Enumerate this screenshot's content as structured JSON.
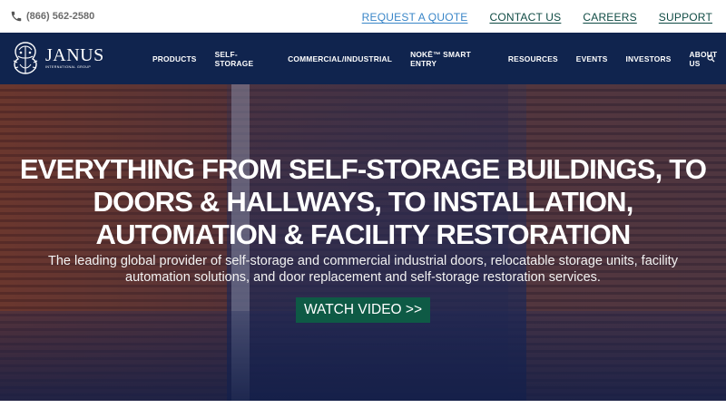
{
  "topbar": {
    "phone_icon": "phone-icon",
    "phone": "(866) 562-2580",
    "links": [
      "REQUEST A QUOTE",
      "CONTACT US",
      "CAREERS",
      "SUPPORT"
    ]
  },
  "navbar": {
    "logo": {
      "word": "JANUS",
      "sub": "INTERNATIONAL GROUP"
    },
    "items": [
      "PRODUCTS",
      "SELF-STORAGE",
      "COMMERCIAL/INDUSTRIAL",
      "NOKĒ™ SMART ENTRY",
      "RESOURCES",
      "EVENTS",
      "INVESTORS",
      "ABOUT US"
    ],
    "search_icon": "search-icon"
  },
  "hero": {
    "headline": "EVERYTHING FROM SELF-STORAGE BUILDINGS, TO DOORS & HALLWAYS, TO INSTALLATION, AUTOMATION & FACILITY RESTORATION",
    "subline": "The leading global provider of self-storage and commercial industrial doors, relocatable storage units, facility automation solutions, and door replacement and self-storage restoration services.",
    "button": "WATCH VIDEO >>"
  },
  "colors": {
    "nav_bg": "#10244e",
    "button_bg": "#0e5a45",
    "quote_link": "#3a86c8",
    "dark_link": "#0f4b44"
  }
}
